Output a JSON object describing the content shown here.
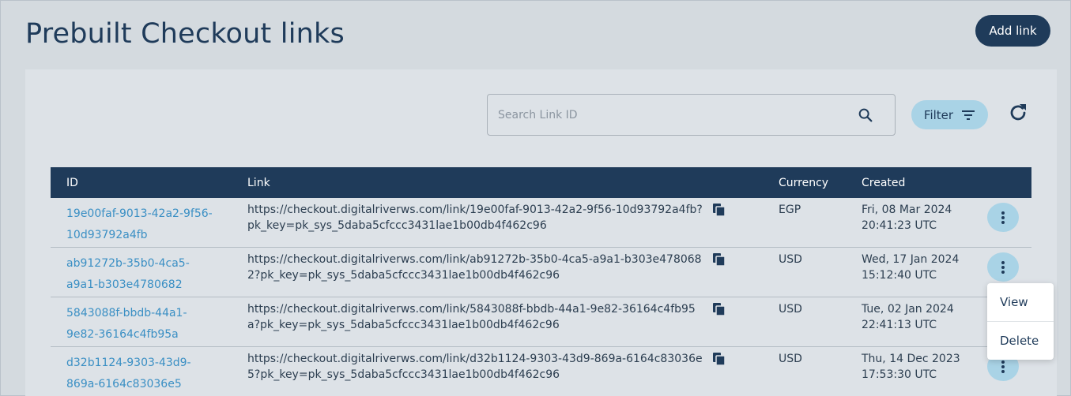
{
  "page": {
    "title": "Prebuilt Checkout links"
  },
  "header": {
    "add_label": "Add link"
  },
  "search": {
    "placeholder": "Search Link ID"
  },
  "filter": {
    "label": "Filter"
  },
  "table": {
    "columns": {
      "id": "ID",
      "link": "Link",
      "currency": "Currency",
      "created": "Created"
    },
    "rows": [
      {
        "id_line1": "19e00faf-9013-42a2-9f56-",
        "id_line2": "10d93792a4fb",
        "link": "https://checkout.digitalriverws.com/link/19e00faf-9013-42a2-9f56-10d93792a4fb?pk_key=pk_sys_5daba5cfccc3431lae1b00db4f462c96",
        "currency": "EGP",
        "created_line1": "Fri, 08 Mar 2024",
        "created_line2": "20:41:23 UTC"
      },
      {
        "id_line1": "ab91272b-35b0-4ca5-",
        "id_line2": "a9a1-b303e4780682",
        "link": "https://checkout.digitalriverws.com/link/ab91272b-35b0-4ca5-a9a1-b303e4780682?pk_key=pk_sys_5daba5cfccc3431lae1b00db4f462c96",
        "currency": "USD",
        "created_line1": "Wed, 17 Jan 2024",
        "created_line2": "15:12:40 UTC"
      },
      {
        "id_line1": "5843088f-bbdb-44a1-",
        "id_line2": "9e82-36164c4fb95a",
        "link": "https://checkout.digitalriverws.com/link/5843088f-bbdb-44a1-9e82-36164c4fb95a?pk_key=pk_sys_5daba5cfccc3431lae1b00db4f462c96",
        "currency": "USD",
        "created_line1": "Tue, 02 Jan 2024",
        "created_line2": "22:41:13 UTC"
      },
      {
        "id_line1": "d32b1124-9303-43d9-",
        "id_line2": "869a-6164c83036e5",
        "link": "https://checkout.digitalriverws.com/link/d32b1124-9303-43d9-869a-6164c83036e5?pk_key=pk_sys_5daba5cfccc3431lae1b00db4f462c96",
        "currency": "USD",
        "created_line1": "Thu, 14 Dec 2023",
        "created_line2": "17:53:30 UTC"
      }
    ]
  },
  "menu": {
    "items": [
      "View",
      "Delete"
    ]
  },
  "icons": {
    "search": "search-icon",
    "filter": "filter-icon",
    "refresh": "refresh-icon",
    "copy": "copy-icon",
    "more": "more-vertical-icon"
  },
  "colors": {
    "primary": "#1f3b5a",
    "accent_light": "#a9d3e6",
    "link": "#3a8fc4",
    "background": "#d4dadf"
  }
}
